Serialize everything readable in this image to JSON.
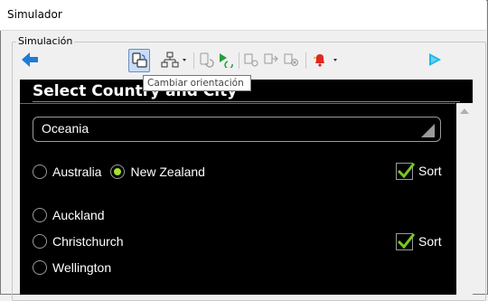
{
  "window": {
    "title": "Simulador"
  },
  "group": {
    "label": "Simulación"
  },
  "toolbar": {
    "back_icon": "arrow-left-icon",
    "play_icon": "play-icon",
    "tooltip": "Cambiar orientación"
  },
  "app": {
    "title": "Select Country and City",
    "dropdown": {
      "value": "Oceania"
    },
    "countries": [
      {
        "label": "Australia",
        "selected": false
      },
      {
        "label": "New Zealand",
        "selected": true
      }
    ],
    "country_sort": {
      "label": "Sort",
      "checked": true
    },
    "cities": [
      {
        "label": "Auckland",
        "selected": false
      },
      {
        "label": "Christchurch",
        "selected": false
      },
      {
        "label": "Wellington",
        "selected": false
      }
    ],
    "city_sort": {
      "label": "Sort",
      "checked": true
    }
  },
  "colors": {
    "accent_green": "#a6e22e",
    "check_green": "#7acb1f",
    "back_arrow": "#1e7bd8",
    "play_arrow": "#1fb7e6"
  }
}
